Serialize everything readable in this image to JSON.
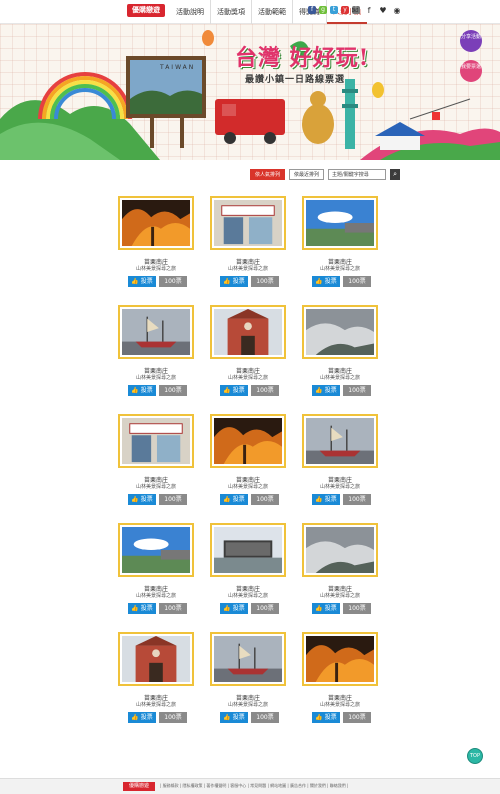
{
  "header": {
    "logo_text": "優購戀遊",
    "nav": [
      "活動說明",
      "活動獎項",
      "活動範範",
      "得獎賞",
      "人氣小鎮"
    ],
    "social": [
      {
        "icon": "f",
        "color": "#3b5998"
      },
      {
        "icon": "g",
        "color": "#6fbf3a"
      },
      {
        "icon": "t",
        "color": "#3aa0d8"
      },
      {
        "icon": "y",
        "color": "#d33"
      },
      {
        "icon": "i",
        "color": "#777"
      }
    ],
    "share_icons": [
      "✉",
      "f",
      "♥",
      "◉"
    ]
  },
  "banner": {
    "title": "台灣 好好玩!",
    "subtitle": "最讚小鎮一日路線票選",
    "taiwan_label": "TAIWAN",
    "badge_share": "分享活動",
    "badge_vote": "我要票選"
  },
  "toolbar": {
    "sort_popular": "依人氣排列",
    "sort_upload": "依最近排列",
    "search_placeholder": "主題/關鍵字搜尋",
    "search_icon": "⌕"
  },
  "cards": [
    {
      "name": "苗栗南庄",
      "desc": "山林美景探尋之旅",
      "votes": "100票",
      "vote_label": "投票",
      "theme": "autumn"
    },
    {
      "name": "苗栗南庄",
      "desc": "山林美景探尋之旅",
      "votes": "100票",
      "vote_label": "投票",
      "theme": "shop"
    },
    {
      "name": "苗栗南庄",
      "desc": "山林美景探尋之旅",
      "votes": "100票",
      "vote_label": "投票",
      "theme": "sky"
    },
    {
      "name": "苗栗南庄",
      "desc": "山林美景探尋之旅",
      "votes": "100票",
      "vote_label": "投票",
      "theme": "ship"
    },
    {
      "name": "苗栗南庄",
      "desc": "山林美景探尋之旅",
      "votes": "100票",
      "vote_label": "投票",
      "theme": "church"
    },
    {
      "name": "苗栗南庄",
      "desc": "山林美景探尋之旅",
      "votes": "100票",
      "vote_label": "投票",
      "theme": "valley"
    },
    {
      "name": "苗栗南庄",
      "desc": "山林美景探尋之旅",
      "votes": "100票",
      "vote_label": "投票",
      "theme": "shop"
    },
    {
      "name": "苗栗南庄",
      "desc": "山林美景探尋之旅",
      "votes": "100票",
      "vote_label": "投票",
      "theme": "autumn"
    },
    {
      "name": "苗栗南庄",
      "desc": "山林美景探尋之旅",
      "votes": "100票",
      "vote_label": "投票",
      "theme": "ship"
    },
    {
      "name": "苗栗南庄",
      "desc": "山林美景探尋之旅",
      "votes": "100票",
      "vote_label": "投票",
      "theme": "sky"
    },
    {
      "name": "苗栗南庄",
      "desc": "山林美景探尋之旅",
      "votes": "100票",
      "vote_label": "投票",
      "theme": "hall"
    },
    {
      "name": "苗栗南庄",
      "desc": "山林美景探尋之旅",
      "votes": "100票",
      "vote_label": "投票",
      "theme": "valley"
    },
    {
      "name": "苗栗南庄",
      "desc": "山林美景探尋之旅",
      "votes": "100票",
      "vote_label": "投票",
      "theme": "church"
    },
    {
      "name": "苗栗南庄",
      "desc": "山林美景探尋之旅",
      "votes": "100票",
      "vote_label": "投票",
      "theme": "ship"
    },
    {
      "name": "苗栗南庄",
      "desc": "山林美景探尋之旅",
      "votes": "100票",
      "vote_label": "投票",
      "theme": "autumn"
    }
  ],
  "top_button": "TOP",
  "footer": {
    "logo_text": "優購戀遊",
    "links": "| 服務條款 | 隱私權政策 | 著作權聲明 | 客服中心 | 常見問題 | 網站地圖 | 廣告合作 | 關於我們 | 聯絡我們 |"
  }
}
